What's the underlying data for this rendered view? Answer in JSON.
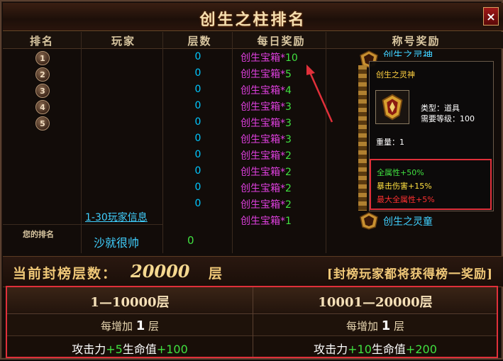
{
  "window": {
    "title": "创生之柱排名",
    "close_label": "×"
  },
  "columns": [
    "排名",
    "玩家",
    "层数",
    "每日奖励",
    "称号奖励"
  ],
  "rows": [
    {
      "rank": "1",
      "player": "",
      "floor": "0",
      "reward_name": "创生宝箱",
      "reward_qty": "10"
    },
    {
      "rank": "2",
      "player": "",
      "floor": "0",
      "reward_name": "创生宝箱",
      "reward_qty": "5"
    },
    {
      "rank": "3",
      "player": "",
      "floor": "0",
      "reward_name": "创生宝箱",
      "reward_qty": "4"
    },
    {
      "rank": "4",
      "player": "",
      "floor": "0",
      "reward_name": "创生宝箱",
      "reward_qty": "3"
    },
    {
      "rank": "5",
      "player": "",
      "floor": "0",
      "reward_name": "创生宝箱",
      "reward_qty": "3"
    },
    {
      "rank": "",
      "player": "",
      "floor": "0",
      "reward_name": "创生宝箱",
      "reward_qty": "3"
    },
    {
      "rank": "",
      "player": "",
      "floor": "0",
      "reward_name": "创生宝箱",
      "reward_qty": "2"
    },
    {
      "rank": "",
      "player": "",
      "floor": "0",
      "reward_name": "创生宝箱",
      "reward_qty": "2"
    },
    {
      "rank": "",
      "player": "",
      "floor": "0",
      "reward_name": "创生宝箱",
      "reward_qty": "2"
    },
    {
      "rank": "",
      "player": "",
      "floor": "0",
      "reward_name": "创生宝箱",
      "reward_qty": "2"
    },
    {
      "rank": "",
      "player": "",
      "floor": "",
      "reward_name": "创生宝箱",
      "reward_qty": "1"
    }
  ],
  "title_rewards": {
    "top_partial": "创生之灵神",
    "bottom": "创生之灵童"
  },
  "player_info_link": "1-30玩家信息",
  "my_rank": {
    "label": "您的排名",
    "player": "沙就很帅",
    "floor": "0"
  },
  "tooltip": {
    "title": "创生之灵神",
    "type": "类型：道具",
    "level": "需要等级：100",
    "weight": "重量：1",
    "stats": [
      {
        "text": "全属性+50%",
        "color": "#40e040"
      },
      {
        "text": "暴击伤害+15%",
        "color": "#ffe040"
      },
      {
        "text": "最大全属性+5%",
        "color": "#ff3030"
      }
    ]
  },
  "seal": {
    "label": "当前封榜层数：",
    "value": "20000",
    "unit": "层",
    "note": "[封榜玩家都将获得榜一奖励]"
  },
  "bonus": [
    {
      "range": "1—10000层",
      "per_prefix": "每增加",
      "per_num": "1",
      "per_unit": "层",
      "atk_label": "攻击力",
      "atk": "+5",
      "hp_label": "生命值",
      "hp": "+100"
    },
    {
      "range": "10001—20000层",
      "per_prefix": "每增加",
      "per_num": "1",
      "per_unit": "层",
      "atk_label": "攻击力",
      "atk": "+10",
      "hp_label": "生命值",
      "hp": "+200"
    }
  ],
  "colors": {
    "highlight_box": "#e0303a",
    "reward_name": "#e040e0",
    "qty": "#40e040",
    "floor": "#00c8ff"
  }
}
